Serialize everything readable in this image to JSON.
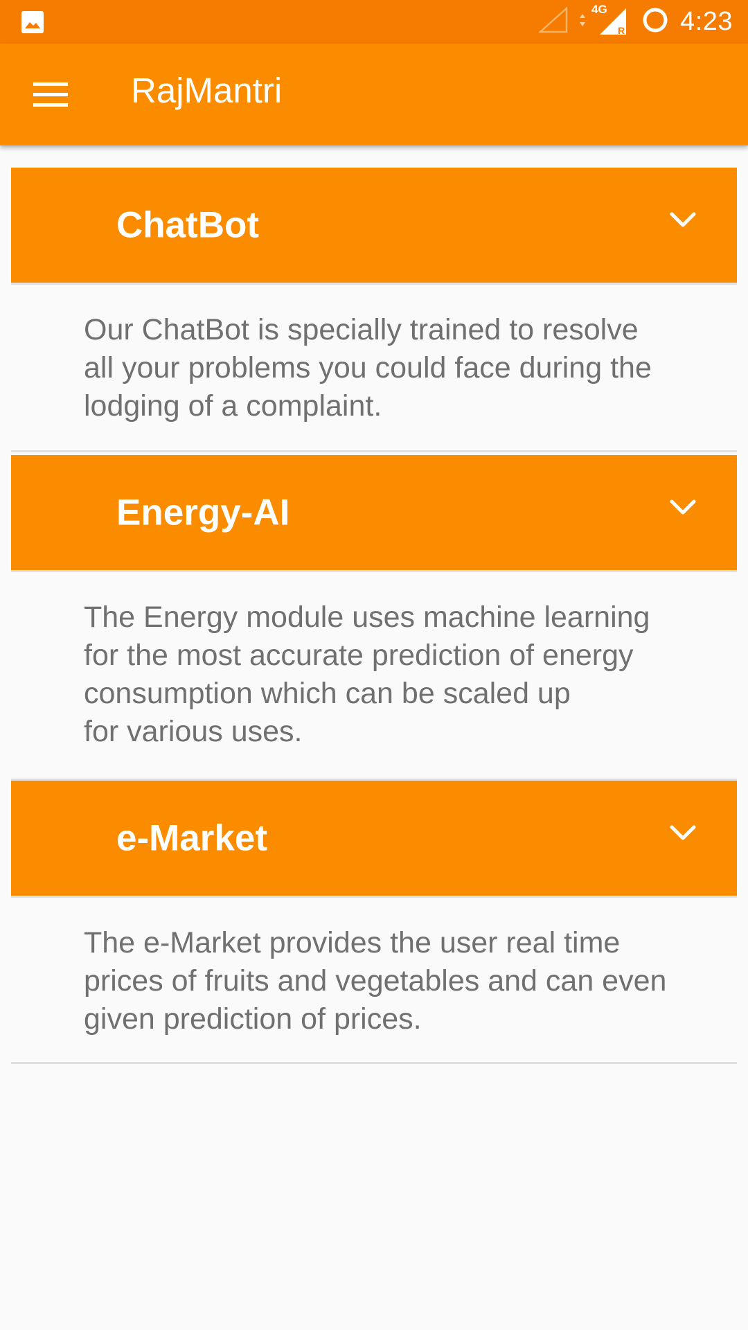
{
  "status_bar": {
    "time": "4:23",
    "network_label": "4G",
    "roaming_label": "R",
    "icons": [
      "image-notification-icon",
      "signal-empty-icon",
      "data-arrows-icon",
      "signal-4g-icon",
      "battery-ring-icon"
    ]
  },
  "app_bar": {
    "title": "RajMantri",
    "menu_icon": "hamburger-menu-icon"
  },
  "colors": {
    "status_bar": "#f57c00",
    "accent": "#fb8c00",
    "header_text": "#ffffff",
    "body_text": "#707070",
    "background": "#fafafa",
    "divider": "#e0e0e0"
  },
  "sections": [
    {
      "title": "ChatBot",
      "description_lines": [
        "Our ChatBot is specially trained to resolve",
        "all your problems you could face during the",
        "lodging of a complaint."
      ],
      "icon": "chevron-down-icon"
    },
    {
      "title": "Energy-AI",
      "description_lines": [
        "The Energy module uses machine learning",
        "for the most accurate prediction of energy",
        "consumption which can be scaled up",
        "for various uses."
      ],
      "icon": "chevron-down-icon"
    },
    {
      "title": "e-Market",
      "description_lines": [
        "The e-Market provides the user real time",
        "prices of fruits and vegetables and can even",
        "given prediction of prices."
      ],
      "icon": "chevron-down-icon"
    }
  ]
}
